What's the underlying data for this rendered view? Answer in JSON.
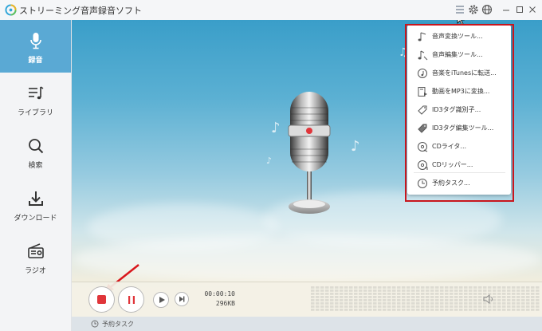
{
  "app": {
    "title": "ストリーミング音声録音ソフト"
  },
  "window_controls": [
    "list-icon",
    "gear-icon",
    "globe-icon",
    "minimize-icon",
    "maximize-icon",
    "close-icon"
  ],
  "sidebar": {
    "items": [
      {
        "label": "録音",
        "icon": "microphone-icon",
        "active": true
      },
      {
        "label": "ライブラリ",
        "icon": "library-icon"
      },
      {
        "label": "検索",
        "icon": "search-icon"
      },
      {
        "label": "ダウンロード",
        "icon": "download-icon"
      },
      {
        "label": "ラジオ",
        "icon": "radio-icon"
      }
    ]
  },
  "menu": {
    "items": [
      {
        "label": "音声変換ツール...",
        "icon": "music-note-icon"
      },
      {
        "label": "音声編集ツール...",
        "icon": "music-edit-icon"
      },
      {
        "label": "音楽をiTunesに転送...",
        "icon": "itunes-icon"
      },
      {
        "label": "動画をMP3に変換...",
        "icon": "video-convert-icon"
      },
      {
        "label": "ID3タグ識別子...",
        "icon": "tag-icon"
      },
      {
        "label": "ID3タグ編集ツール...",
        "icon": "tag-edit-icon"
      },
      {
        "label": "CDライタ...",
        "icon": "cd-burn-icon"
      },
      {
        "label": "CDリッパー...",
        "icon": "cd-rip-icon"
      },
      {
        "label": "予約タスク...",
        "icon": "clock-icon"
      }
    ]
  },
  "player": {
    "time": "00:00:10",
    "size": "296KB"
  },
  "status": {
    "schedule_label": "予約タスク"
  },
  "colors": {
    "accent": "#5aa9d4",
    "record": "#e0353a",
    "highlight": "#c8161d"
  }
}
